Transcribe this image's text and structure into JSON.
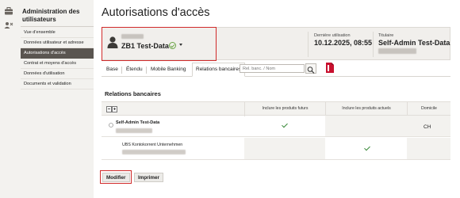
{
  "sidebar": {
    "title": "Administration des utilisateurs",
    "items": [
      {
        "label": "Vue d'ensemble",
        "active": false
      },
      {
        "label": "Données utilisateur et adresse",
        "active": false
      },
      {
        "label": "Autorisations d'accès",
        "active": true
      },
      {
        "label": "Contrat et moyens d'accès",
        "active": false
      },
      {
        "label": "Données d'utilisation",
        "active": false
      },
      {
        "label": "Documents et validation",
        "active": false
      }
    ]
  },
  "page": {
    "title": "Autorisations d'accès"
  },
  "account": {
    "name": "ZB1 Test-Data"
  },
  "header": {
    "last_use_label": "Dernière utilisation",
    "last_use_value": "10.12.2025, 08:55",
    "holder_label": "Titulaire",
    "holder_value": "Self-Admin Test-Data"
  },
  "tabs": [
    "Base",
    "Étendu",
    "Mobile Banking",
    "Relations bancaires"
  ],
  "active_tab": "Relations bancaires",
  "search": {
    "placeholder": "Rel. banc. / Nom"
  },
  "section": {
    "title": "Relations bancaires"
  },
  "table": {
    "columns": [
      "Inclure les produits futurs",
      "Inclure les produits actuels",
      "Domicile"
    ],
    "rows": [
      {
        "name": "Self-Admin Test-Data",
        "future": true,
        "current": false,
        "domicile": "CH"
      },
      {
        "name": "UBS Kontokorrent Unternehmen",
        "future": false,
        "current": true,
        "domicile": ""
      }
    ]
  },
  "buttons": {
    "modify": "Modifier",
    "print": "Imprimer"
  },
  "colors": {
    "highlight": "#d02a2a",
    "check": "#3a8a3a",
    "pdf": "#c8102e"
  }
}
